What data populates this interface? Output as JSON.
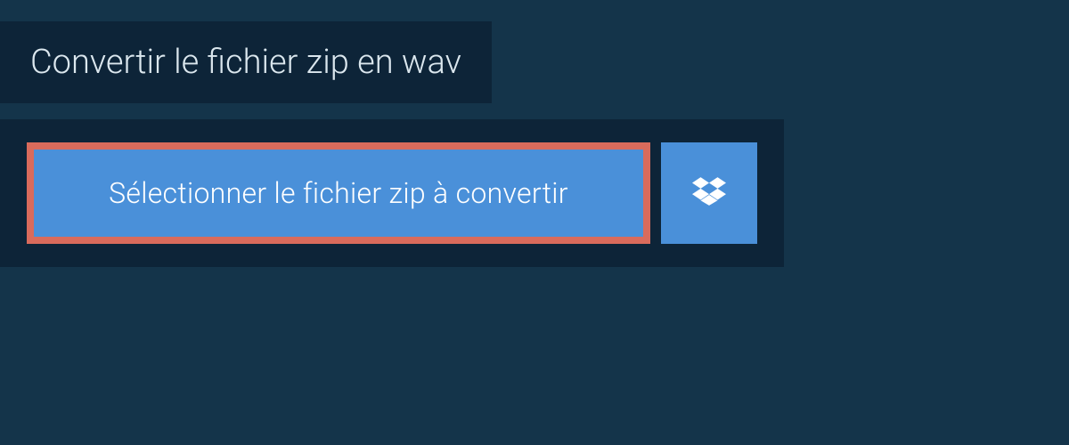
{
  "header": {
    "title": "Convertir le fichier zip en wav"
  },
  "actions": {
    "select_file_label": "Sélectionner le fichier zip à convertir"
  },
  "colors": {
    "bg_outer": "#14344a",
    "bg_panel": "#0d2438",
    "button_bg": "#4a90d9",
    "highlight_border": "#d96b5c",
    "text_light": "#ffffff"
  }
}
